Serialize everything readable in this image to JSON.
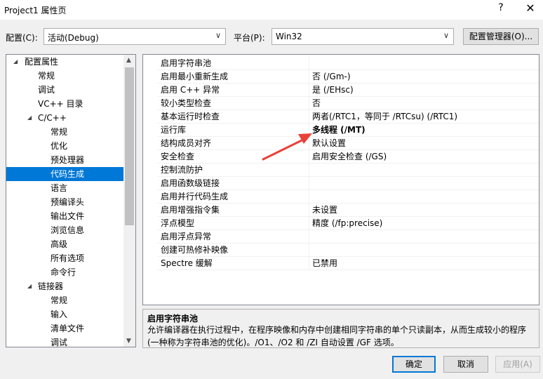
{
  "window": {
    "title": "Project1 属性页",
    "help_glyph": "?",
    "close_glyph": "✕"
  },
  "config": {
    "config_label": "配置(C):",
    "config_value": "活动(Debug)",
    "platform_label": "平台(P):",
    "platform_value": "Win32",
    "manager_button": "配置管理器(O)..."
  },
  "tree": {
    "items": [
      {
        "label": "配置属性",
        "toggle": "◢"
      },
      {
        "label": "常规"
      },
      {
        "label": "调试"
      },
      {
        "label": "VC++ 目录"
      },
      {
        "label": "C/C++",
        "toggle": "◢"
      },
      {
        "label": "常规"
      },
      {
        "label": "优化"
      },
      {
        "label": "预处理器"
      },
      {
        "label": "代码生成",
        "selected": true
      },
      {
        "label": "语言"
      },
      {
        "label": "预编译头"
      },
      {
        "label": "输出文件"
      },
      {
        "label": "浏览信息"
      },
      {
        "label": "高级"
      },
      {
        "label": "所有选项"
      },
      {
        "label": "命令行"
      },
      {
        "label": "链接器",
        "toggle": "◢"
      },
      {
        "label": "常规"
      },
      {
        "label": "输入"
      },
      {
        "label": "清单文件"
      },
      {
        "label": "调试"
      }
    ]
  },
  "properties": [
    {
      "name": "启用字符串池",
      "value": ""
    },
    {
      "name": "启用最小重新生成",
      "value": "否 (/Gm-)"
    },
    {
      "name": "启用 C++ 异常",
      "value": "是 (/EHsc)"
    },
    {
      "name": "较小类型检查",
      "value": "否"
    },
    {
      "name": "基本运行时检查",
      "value": "两者(/RTC1，等同于 /RTCsu) (/RTC1)"
    },
    {
      "name": "运行库",
      "value": "多线程 (/MT)",
      "bold": true
    },
    {
      "name": "结构成员对齐",
      "value": "默认设置"
    },
    {
      "name": "安全检查",
      "value": "启用安全检查 (/GS)"
    },
    {
      "name": "控制流防护",
      "value": ""
    },
    {
      "name": "启用函数级链接",
      "value": ""
    },
    {
      "name": "启用并行代码生成",
      "value": ""
    },
    {
      "name": "启用增强指令集",
      "value": "未设置"
    },
    {
      "name": "浮点模型",
      "value": "精度 (/fp:precise)"
    },
    {
      "name": "启用浮点异常",
      "value": ""
    },
    {
      "name": "创建可热修补映像",
      "value": ""
    },
    {
      "name": "Spectre 缓解",
      "value": "已禁用"
    }
  ],
  "description": {
    "title": "启用字符串池",
    "text": "允许编译器在执行过程中，在程序映像和内存中创建相同字符串的单个只读副本，从而生成较小的程序(一种称为字符串池的优化)。/O1、/O2 和 /ZI 自动设置 /GF 选项。"
  },
  "buttons": {
    "ok": "确定",
    "cancel": "取消",
    "apply": "应用(A)"
  },
  "annotation": {
    "color": "#e8413a"
  }
}
